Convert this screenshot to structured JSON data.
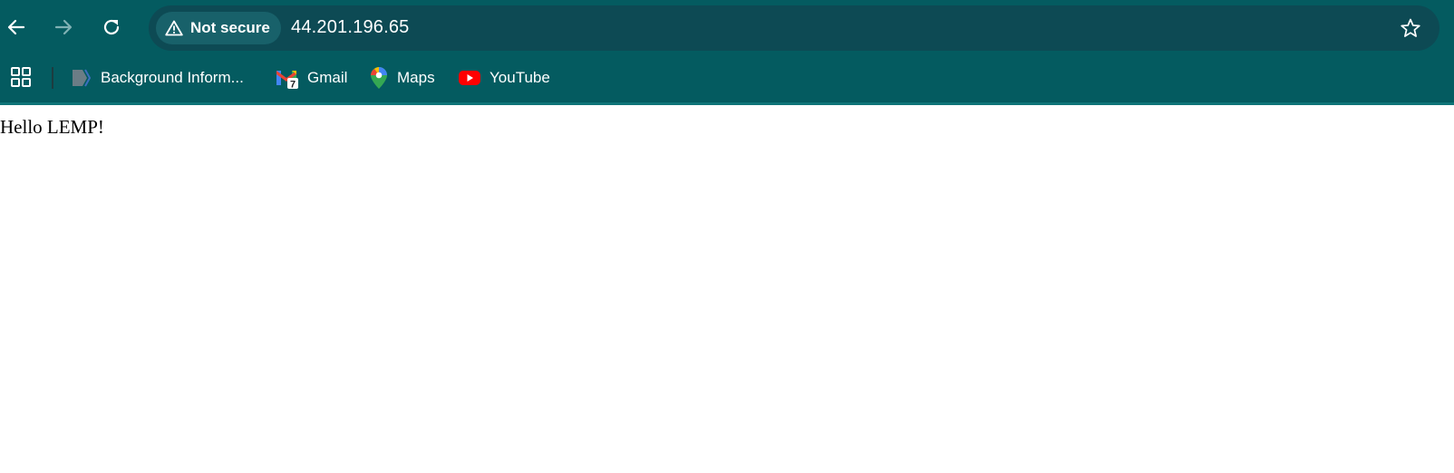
{
  "toolbar": {
    "back_icon": "arrow-left-icon",
    "forward_icon": "arrow-right-icon",
    "reload_icon": "reload-icon"
  },
  "omnibox": {
    "security_label": "Not secure",
    "security_icon": "warning-triangle-icon",
    "url": "44.201.196.65",
    "bookmark_star_icon": "star-outline-icon"
  },
  "bookmarks": {
    "apps_icon": "apps-grid-icon",
    "items": [
      {
        "label": "Background Inform...",
        "icon": "bookmark-favicon"
      },
      {
        "label": "Gmail",
        "icon": "gmail-icon",
        "badge": "7"
      },
      {
        "label": "Maps",
        "icon": "maps-pin-icon"
      },
      {
        "label": "YouTube",
        "icon": "youtube-icon"
      }
    ]
  },
  "page": {
    "body_text": "Hello LEMP!"
  },
  "colors": {
    "toolbar_bg": "#045b60",
    "omnibox_bg": "#0d4a54",
    "chip_bg": "#18616a",
    "page_bg": "#ffffff"
  }
}
